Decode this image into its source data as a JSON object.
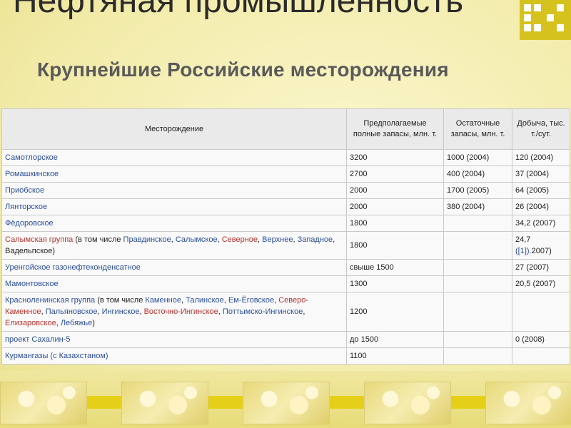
{
  "slide": {
    "title": "Нефтяная промышленность",
    "subtitle": "Крупнейшие Российские месторождения"
  },
  "table": {
    "headers": [
      "Месторождение",
      "Предполагаемые полные запасы, млн. т.",
      "Остаточные запасы, млн. т.",
      "Добыча, тыс. т./сут."
    ],
    "rows": [
      {
        "name": "Самотлорское",
        "total": "3200",
        "residual": "1000 (2004)",
        "output": "120 (2004)"
      },
      {
        "name": "Ромашкинское",
        "total": "2700",
        "residual": "400 (2004)",
        "output": "37 (2004)"
      },
      {
        "name": "Приобское",
        "total": "2000",
        "residual": "1700 (2005)",
        "output": "64 (2005)"
      },
      {
        "name": "Лянторское",
        "total": "2000",
        "residual": "380 (2004)",
        "output": "26 (2004)"
      },
      {
        "name": "Фёдоровское",
        "total": "1800",
        "residual": "",
        "output": "34,2 (2007)"
      },
      {
        "name_parts": [
          "Салымская группа",
          " (в том числе ",
          "Правдинское",
          ", ",
          "Салымское",
          ", ",
          "Северное",
          ", ",
          "Верхнее",
          ", ",
          "Западное",
          ", ",
          "Вадельпское",
          ")"
        ],
        "total": "1800",
        "residual": "",
        "output_line1": "24,7",
        "output_line2_a": "([1]).",
        "output_line2_b": "2007)"
      },
      {
        "name": "Уренгойское газонефтеконденсатное",
        "total": "свыше 1500",
        "residual": "",
        "output": "27 (2007)"
      },
      {
        "name": "Мамонтовское",
        "total": "1300",
        "residual": "",
        "output": "20,5 (2007)"
      },
      {
        "name_parts": [
          "Красноленинская группа",
          " (в том числе ",
          "Каменное",
          ", ",
          "Талинское",
          ", ",
          "Ем-Ёговское",
          ", ",
          "Северо-Каменное",
          ", ",
          "Пальяновское",
          ", ",
          "Ингинское",
          ", ",
          "Восточно-Ингинское",
          ", ",
          "Поттымско-Ингинское",
          ", ",
          "Елизаровское",
          ", ",
          "Лебяжье",
          ")"
        ],
        "total": "1200",
        "residual": "",
        "output": ""
      },
      {
        "name": "проект Сахалин-5",
        "total": "до 1500",
        "residual": "",
        "output": "0 (2008)"
      },
      {
        "name": "Курмангазы (с Казахстаном)",
        "total": "1100",
        "residual": "",
        "output": ""
      }
    ]
  },
  "colors": {
    "link": "#2c4f9a",
    "redlink": "#b5322e",
    "accent": "#d6c21f",
    "background": "#f4efb6"
  }
}
